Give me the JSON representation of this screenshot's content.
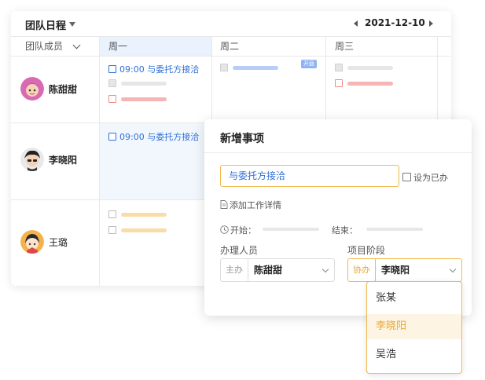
{
  "calendar": {
    "title": "团队日程",
    "date": "2021-12-10",
    "member_header": "团队成员",
    "days": [
      "周一",
      "周二",
      "周三"
    ],
    "members": [
      {
        "name": "陈甜甜"
      },
      {
        "name": "李晓阳"
      },
      {
        "name": "王璐"
      }
    ],
    "tasks": {
      "row1_mon": "09:00 与委托方接洽",
      "row2_mon": "09:00 与委托方接洽",
      "tue_tag": "开庭"
    },
    "colors": {
      "blue": "#2f6fd6",
      "pink": "#f5b5b5",
      "yellow": "#f8dcaa",
      "gray": "#e6e6e6",
      "light_blue": "#b7cdf6"
    }
  },
  "panel": {
    "title": "新增事项",
    "input_value": "与委托方接洽",
    "done_label": "设为已办",
    "add_detail": "添加工作详情",
    "start_label": "开始：",
    "end_label": "结束：",
    "assignee_label": "办理人员",
    "stage_label": "项目阶段",
    "main_prefix": "主办",
    "main_value": "陈甜甜",
    "assist_prefix": "协办",
    "assist_value": "李晓阳"
  },
  "dropdown": {
    "options": [
      "张某",
      "李晓阳",
      "吴浩"
    ],
    "selected": "李晓阳"
  },
  "icons": [
    "caret-down-icon",
    "caret-left-icon",
    "caret-right-icon",
    "chevron-down-icon",
    "document-icon",
    "clock-icon"
  ]
}
